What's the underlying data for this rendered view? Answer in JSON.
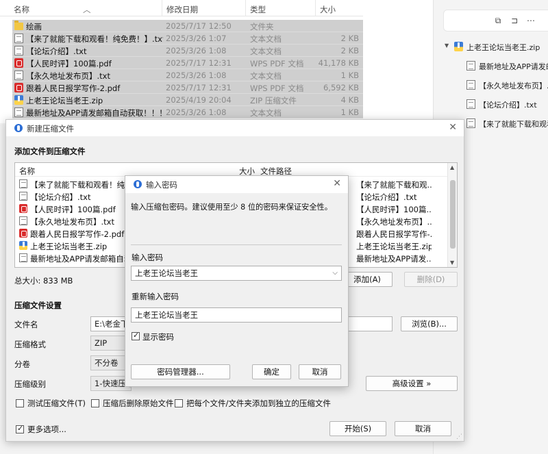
{
  "explorer": {
    "columns": {
      "name": "名称",
      "date": "修改日期",
      "type": "类型",
      "size": "大小"
    },
    "rows": [
      {
        "icon": "folder-icon",
        "name": "绘画",
        "date": "2025/7/17 12:50",
        "type": "文件夹",
        "size": ""
      },
      {
        "icon": "text-file-icon",
        "name": "【来了就能下载和观看！纯免费！】.txt",
        "date": "2025/3/26 1:07",
        "type": "文本文档",
        "size": "2 KB"
      },
      {
        "icon": "text-file-icon",
        "name": "【论坛介绍】.txt",
        "date": "2025/3/26 1:08",
        "type": "文本文档",
        "size": "2 KB"
      },
      {
        "icon": "pdf-file-icon",
        "name": "【人民时评】100篇.pdf",
        "date": "2025/7/17 12:31",
        "type": "WPS PDF 文档",
        "size": "41,178 KB"
      },
      {
        "icon": "text-file-icon",
        "name": "【永久地址发布页】.txt",
        "date": "2025/3/26 1:08",
        "type": "文本文档",
        "size": "1 KB"
      },
      {
        "icon": "pdf-file-icon",
        "name": "跟着人民日报学写作-2.pdf",
        "date": "2025/7/17 12:31",
        "type": "WPS PDF 文档",
        "size": "6,592 KB"
      },
      {
        "icon": "zip-file-icon",
        "name": "上老王论坛当老王.zip",
        "date": "2025/4/19 20:04",
        "type": "ZIP 压缩文件",
        "size": "4 KB"
      },
      {
        "icon": "text-file-icon",
        "name": "最新地址及APP请发邮箱自动获取！！！....",
        "date": "2025/3/26 1:08",
        "type": "文本文档",
        "size": "1 KB"
      }
    ]
  },
  "side_panel": {
    "root": "上老王论坛当老王.zip",
    "children": [
      "最新地址及APP请发邮",
      "【永久地址发布页】.txt",
      "【论坛介绍】.txt",
      "【来了就能下载和观看"
    ]
  },
  "compress_dialog": {
    "title": "新建压缩文件",
    "add_section": "添加文件到压缩文件",
    "list_columns": {
      "name": "名称",
      "size": "大小",
      "path": "文件路径"
    },
    "files": [
      {
        "icon": "text-file-icon",
        "name": "【来了就能下载和观看！纯免费！】.txt",
        "path": "【来了就能下载和观..."
      },
      {
        "icon": "text-file-icon",
        "name": "【论坛介绍】.txt",
        "path": "【论坛介绍】.txt"
      },
      {
        "icon": "pdf-file-icon",
        "name": "【人民时评】100篇.pdf",
        "path": "【人民时评】100篇..."
      },
      {
        "icon": "text-file-icon",
        "name": "【永久地址发布页】.txt",
        "path": "【永久地址发布页】..."
      },
      {
        "icon": "pdf-file-icon",
        "name": "跟着人民日报学写作-2.pdf",
        "path": "跟着人民日报学写作-..."
      },
      {
        "icon": "zip-file-icon",
        "name": "上老王论坛当老王.zip",
        "path": "上老王论坛当老王.zip"
      },
      {
        "icon": "text-file-icon",
        "name": "最新地址及APP请发邮箱自动获取！！！.txt",
        "path": "最新地址及APP请发..."
      }
    ],
    "total_size": "总大小: 833 MB",
    "add_button": "添加(A)",
    "delete_button": "删除(D)",
    "settings_section": "压缩文件设置",
    "filename_label": "文件名",
    "filename_value": "E:\\老金下载",
    "browse_button": "浏览(B)...",
    "format_label": "压缩格式",
    "format_value": "ZIP",
    "split_label": "分卷",
    "split_value": "不分卷",
    "level_label": "压缩级别",
    "level_value": "1-快速压缩",
    "advanced_button": "高级设置 »",
    "test_label": "测试压缩文件(T)",
    "delete_after_label": "压缩后删除原始文件",
    "separate_label": "把每个文件/文件夹添加到独立的压缩文件",
    "more_options_label": "更多选项...",
    "start_button": "开始(S)",
    "cancel_button": "取消"
  },
  "password_dialog": {
    "title": "输入密码",
    "description": "输入压缩包密码。建议使用至少 8 位的密码来保证安全性。",
    "password_label": "输入密码",
    "password_value": "上老王论坛当老王",
    "confirm_label": "重新输入密码",
    "confirm_value": "上老王论坛当老王",
    "show_password_label": "显示密码",
    "manager_button": "密码管理器...",
    "ok_button": "确定",
    "cancel_button": "取消"
  }
}
